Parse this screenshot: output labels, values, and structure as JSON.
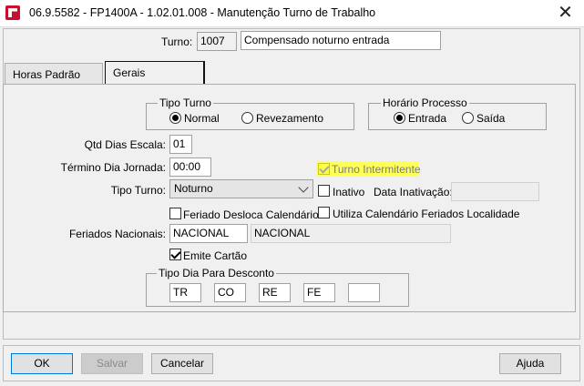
{
  "window": {
    "title": "06.9.5582 - FP1400A - 1.02.01.008 - Manutenção Turno de Trabalho",
    "close_glyph": "✕"
  },
  "header": {
    "turno_label": "Turno:",
    "turno_code": "1007",
    "turno_description": "Compensado noturno entrada"
  },
  "tabs": [
    {
      "label": "Horas Padrão",
      "active": false
    },
    {
      "label": "Gerais",
      "active": true
    }
  ],
  "gerais": {
    "tipo_turno_group": {
      "legend": "Tipo Turno",
      "options": [
        "Normal",
        "Revezamento"
      ],
      "selected": "Normal"
    },
    "horario_processo_group": {
      "legend": "Horário Processo",
      "options": [
        "Entrada",
        "Saída"
      ],
      "selected": "Entrada"
    },
    "qtd_dias_escala": {
      "label": "Qtd Dias Escala:",
      "value": "01"
    },
    "termino_dia_jornada": {
      "label": "Término Dia Jornada:",
      "value": "00:00"
    },
    "turno_intermitente": {
      "label": "Turno Intermitente",
      "checked": true,
      "disabled": true,
      "highlight_color": "#ffff5a"
    },
    "tipo_turno_select": {
      "label": "Tipo Turno:",
      "value": "Noturno"
    },
    "inativo": {
      "label": "Inativo",
      "checked": false
    },
    "data_inativacao": {
      "label": "Data Inativação:",
      "value": ""
    },
    "feriado_desloca": {
      "label": "Feriado Desloca Calendário",
      "checked": false
    },
    "utiliza_calendario": {
      "label": "Utiliza Calendário Feriados Localidade",
      "checked": false
    },
    "feriados_nacionais": {
      "label": "Feriados Nacionais:",
      "code": "NACIONAL",
      "description": "NACIONAL"
    },
    "emite_cartao": {
      "label": "Emite Cartão",
      "checked": true
    },
    "tipo_dia_desconto": {
      "legend": "Tipo Dia Para Desconto",
      "values": [
        "TR",
        "CO",
        "RE",
        "FE",
        ""
      ]
    }
  },
  "footer": {
    "ok": "OK",
    "salvar": "Salvar",
    "cancelar": "Cancelar",
    "ajuda": "Ajuda"
  }
}
